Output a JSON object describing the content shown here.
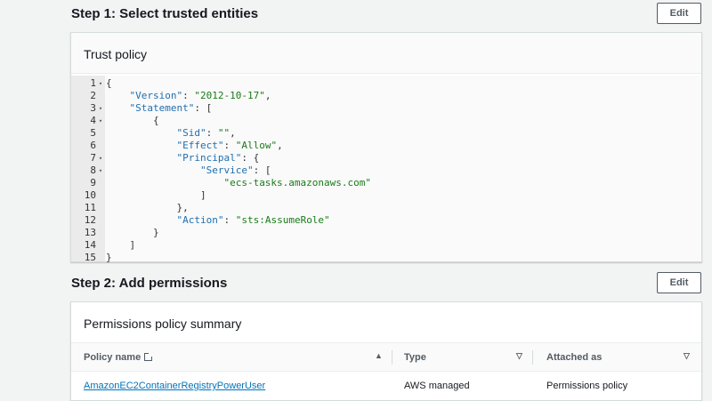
{
  "step1": {
    "title": "Step 1: Select trusted entities",
    "edit_label": "Edit"
  },
  "trust_policy": {
    "header": "Trust policy",
    "lines": [
      {
        "n": "1",
        "fold": true,
        "parts": [
          [
            "p",
            "{"
          ]
        ]
      },
      {
        "n": "2",
        "fold": false,
        "parts": [
          [
            "p",
            "    "
          ],
          [
            "k",
            "\"Version\""
          ],
          [
            "p",
            ": "
          ],
          [
            "s",
            "\"2012-10-17\""
          ],
          [
            "p",
            ","
          ]
        ]
      },
      {
        "n": "3",
        "fold": true,
        "parts": [
          [
            "p",
            "    "
          ],
          [
            "k",
            "\"Statement\""
          ],
          [
            "p",
            ": ["
          ]
        ]
      },
      {
        "n": "4",
        "fold": true,
        "parts": [
          [
            "p",
            "        {"
          ]
        ]
      },
      {
        "n": "5",
        "fold": false,
        "parts": [
          [
            "p",
            "            "
          ],
          [
            "k",
            "\"Sid\""
          ],
          [
            "p",
            ": "
          ],
          [
            "s",
            "\"\""
          ],
          [
            "p",
            ","
          ]
        ]
      },
      {
        "n": "6",
        "fold": false,
        "parts": [
          [
            "p",
            "            "
          ],
          [
            "k",
            "\"Effect\""
          ],
          [
            "p",
            ": "
          ],
          [
            "s",
            "\"Allow\""
          ],
          [
            "p",
            ","
          ]
        ]
      },
      {
        "n": "7",
        "fold": true,
        "parts": [
          [
            "p",
            "            "
          ],
          [
            "k",
            "\"Principal\""
          ],
          [
            "p",
            ": {"
          ]
        ]
      },
      {
        "n": "8",
        "fold": true,
        "parts": [
          [
            "p",
            "                "
          ],
          [
            "k",
            "\"Service\""
          ],
          [
            "p",
            ": ["
          ]
        ]
      },
      {
        "n": "9",
        "fold": false,
        "parts": [
          [
            "p",
            "                    "
          ],
          [
            "s",
            "\"ecs-tasks.amazonaws.com\""
          ]
        ]
      },
      {
        "n": "10",
        "fold": false,
        "parts": [
          [
            "p",
            "                ]"
          ]
        ]
      },
      {
        "n": "11",
        "fold": false,
        "parts": [
          [
            "p",
            "            },"
          ]
        ]
      },
      {
        "n": "12",
        "fold": false,
        "parts": [
          [
            "p",
            "            "
          ],
          [
            "k",
            "\"Action\""
          ],
          [
            "p",
            ": "
          ],
          [
            "s",
            "\"sts:AssumeRole\""
          ]
        ]
      },
      {
        "n": "13",
        "fold": false,
        "parts": [
          [
            "p",
            "        }"
          ]
        ]
      },
      {
        "n": "14",
        "fold": false,
        "parts": [
          [
            "p",
            "    ]"
          ]
        ]
      },
      {
        "n": "15",
        "fold": false,
        "parts": [
          [
            "p",
            "}"
          ]
        ]
      }
    ]
  },
  "step2": {
    "title": "Step 2: Add permissions",
    "edit_label": "Edit"
  },
  "permissions": {
    "header": "Permissions policy summary",
    "columns": {
      "name": "Policy name",
      "type": "Type",
      "attached": "Attached as"
    },
    "rows": [
      {
        "name": "AmazonEC2ContainerRegistryPowerUser",
        "type": "AWS managed",
        "attached": "Permissions policy"
      }
    ]
  },
  "icons": {
    "fold": "caret-down-icon",
    "sort_asc": "sort-up-icon",
    "sort": "sort-down-icon",
    "external": "external-link-icon"
  },
  "colors": {
    "link": "#0073bb",
    "json_key": "#1f6fb0",
    "json_string": "#1a7a1a"
  }
}
